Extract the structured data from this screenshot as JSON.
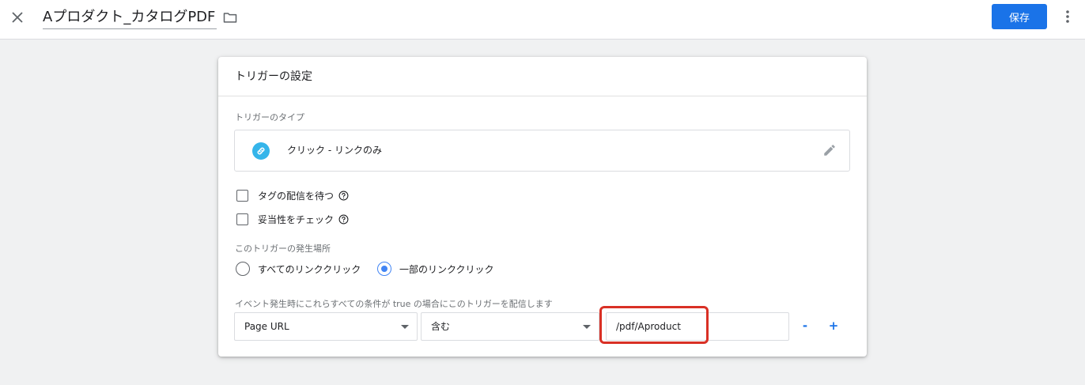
{
  "header": {
    "title": "Aプロダクト_カタログPDF",
    "save_label": "保存",
    "icons": {
      "close": "close-icon",
      "folder": "folder-icon",
      "more": "more-vert-icon"
    }
  },
  "card": {
    "title": "トリガーの設定",
    "trigger_type": {
      "section_label": "トリガーのタイプ",
      "value": "クリック - リンクのみ",
      "icon": "link-icon",
      "icon_color": "#35b5ea"
    },
    "options": [
      {
        "label": "タグの配信を待つ",
        "checked": false
      },
      {
        "label": "妥当性をチェック",
        "checked": false
      }
    ],
    "fire_on": {
      "section_label": "このトリガーの発生場所",
      "options": [
        {
          "label": "すべてのリンククリック",
          "selected": false
        },
        {
          "label": "一部のリンククリック",
          "selected": true
        }
      ]
    },
    "condition": {
      "section_label": "イベント発生時にこれらすべての条件が true の場合にこのトリガーを配信します",
      "variable": "Page URL",
      "operator": "含む",
      "value": "/pdf/Aproduct",
      "remove_label": "-",
      "add_label": "+"
    }
  },
  "colors": {
    "accent": "#1a73e8",
    "highlight": "#d93025",
    "radio": "#4285f4"
  }
}
